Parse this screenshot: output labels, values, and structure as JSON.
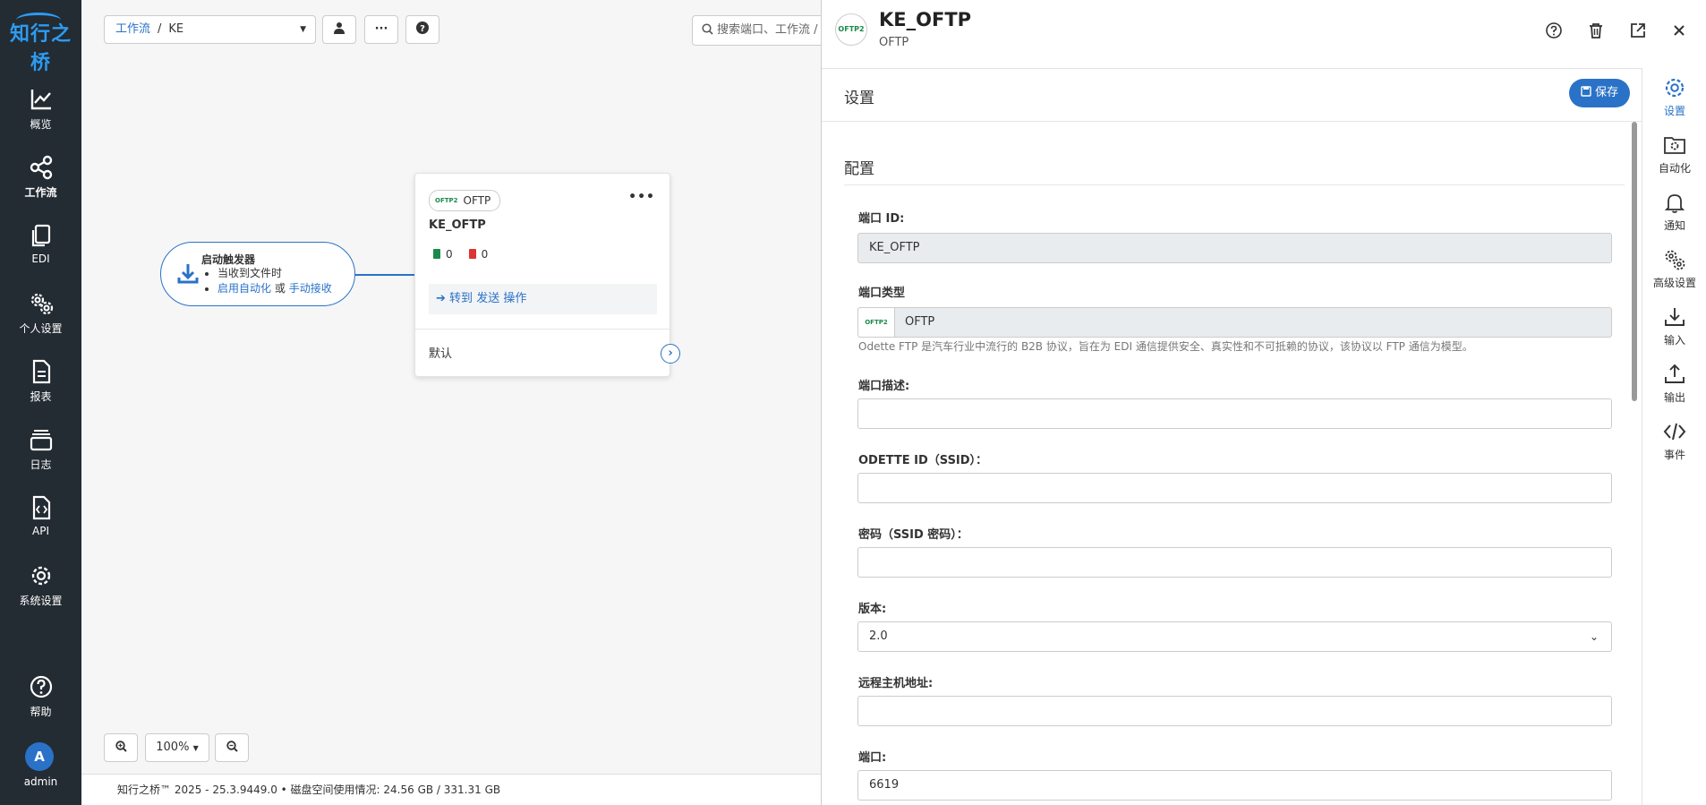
{
  "nav": {
    "logo": "知行之桥",
    "items": [
      {
        "label": "概览",
        "icon": "chart-line-icon"
      },
      {
        "label": "工作流",
        "icon": "share-nodes-icon"
      },
      {
        "label": "EDI",
        "icon": "copy-documents-icon"
      },
      {
        "label": "个人设置",
        "icon": "user-gears-icon"
      },
      {
        "label": "报表",
        "icon": "report-file-icon"
      },
      {
        "label": "日志",
        "icon": "log-stack-icon"
      },
      {
        "label": "API",
        "icon": "api-code-file-icon"
      },
      {
        "label": "系统设置",
        "icon": "gear-icon"
      }
    ],
    "help": "帮助",
    "avatar_letter": "A",
    "user": "admin"
  },
  "canvas": {
    "breadcrumb": {
      "root": "工作流",
      "sep": "/",
      "current": "KE"
    },
    "search_placeholder": "搜索端口、工作流 /",
    "trigger": {
      "title": "启动触发器",
      "line1": "当收到文件时",
      "link1": "启用自动化",
      "or": "或",
      "link2": "手动接收"
    },
    "card": {
      "type": "OFTP",
      "mini_logo": "OFTP2",
      "name": "KE_OFTP",
      "success_count": "0",
      "error_count": "0",
      "goto_prefix": "转到",
      "goto_link": "发送",
      "goto_suffix": "操作",
      "default_label": "默认"
    },
    "zoom": "100%",
    "footer": "知行之桥™ 2025 - 25.3.9449.0  •  磁盘空间使用情况:  24.56 GB / 331.31 GB"
  },
  "panel": {
    "logo": "OFTP2",
    "title": "KE_OFTP",
    "subtitle": "OFTP",
    "section": "设置",
    "save": "保存",
    "config_heading": "配置",
    "fields": {
      "port_id_label": "端口 ID:",
      "port_id_value": "KE_OFTP",
      "port_type_label": "端口类型",
      "port_type_value": "OFTP",
      "port_type_help": "Odette FTP 是汽车行业中流行的 B2B 协议，旨在为 EDI 通信提供安全、真实性和不可抵赖的协议，该协议以 FTP 通信为模型。",
      "desc_label": "端口描述:",
      "desc_value": "",
      "odette_label": "ODETTE ID（SSID）：",
      "odette_value": "",
      "password_label": "密码（SSID 密码）：",
      "password_value": "",
      "version_label": "版本:",
      "version_value": "2.0",
      "host_label": "远程主机地址:",
      "host_value": "",
      "port_label": "端口:",
      "port_value": "6619"
    },
    "rail": [
      {
        "label": "设置",
        "icon": "gear-icon",
        "active": true
      },
      {
        "label": "自动化",
        "icon": "folder-gear-icon"
      },
      {
        "label": "通知",
        "icon": "bell-icon"
      },
      {
        "label": "高级设置",
        "icon": "gears-icon"
      },
      {
        "label": "输入",
        "icon": "download-icon"
      },
      {
        "label": "输出",
        "icon": "upload-icon"
      },
      {
        "label": "事件",
        "icon": "code-icon"
      }
    ]
  },
  "colors": {
    "accent": "#2a72c7",
    "nav_bg": "#232b33",
    "success": "#1a8a4a",
    "error": "#dd3333"
  }
}
